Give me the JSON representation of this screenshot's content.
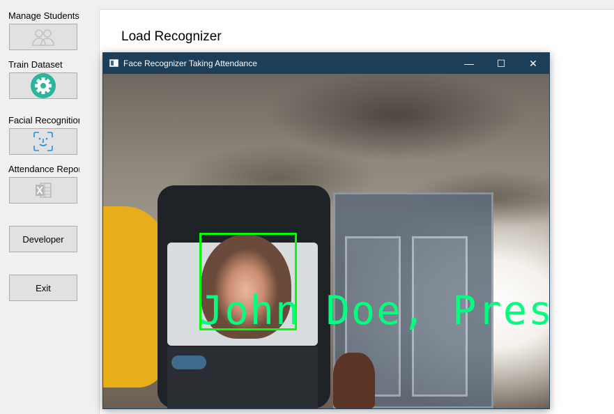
{
  "sidebar": {
    "items": [
      {
        "label": "Manage Students",
        "icon": "users-icon"
      },
      {
        "label": "Train Dataset",
        "icon": "gear-icon"
      },
      {
        "label": "Facial Recognition",
        "icon": "face-scan-icon"
      },
      {
        "label": "Attendance Report",
        "icon": "excel-icon"
      }
    ],
    "developer_label": "Developer",
    "exit_label": "Exit"
  },
  "main": {
    "title": "Load Recognizer"
  },
  "window": {
    "title": "Face Recognizer Taking Attendance",
    "minimize_glyph": "—",
    "maximize_glyph": "☐",
    "close_glyph": "✕",
    "detection_label": "John Doe, Present"
  },
  "colors": {
    "titlebar": "#1c3e59",
    "detection_box": "#00ff00",
    "detection_text": "#00ff7f",
    "gear_icon": "#2bb59a",
    "face_scan_icon": "#1e90e0"
  }
}
